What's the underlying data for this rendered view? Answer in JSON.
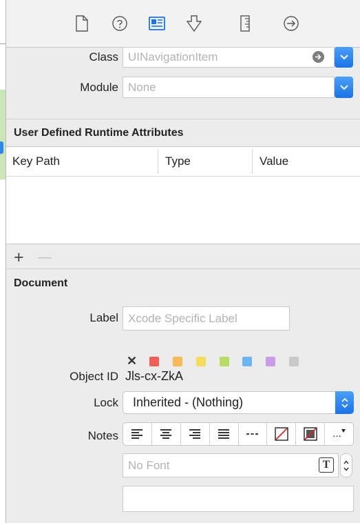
{
  "identity": {
    "class_label": "Class",
    "class_placeholder": "UINavigationItem",
    "module_label": "Module",
    "module_placeholder": "None"
  },
  "runtime_attributes": {
    "title": "User Defined Runtime Attributes",
    "columns": [
      "Key Path",
      "Type",
      "Value"
    ],
    "add_symbol": "+",
    "remove_symbol": "—"
  },
  "document": {
    "title": "Document",
    "label_label": "Label",
    "label_placeholder": "Xcode Specific Label",
    "clear_color_symbol": "✕",
    "color_swatches": [
      "#f25f58",
      "#f7b955",
      "#f4dd5a",
      "#b6dc66",
      "#6cb4f2",
      "#ca9ce6",
      "#c9c9c9"
    ],
    "object_id_label": "Object ID",
    "object_id_value": "Jls-cx-ZkA",
    "lock_label": "Lock",
    "lock_value": "Inherited - (Nothing)",
    "notes_label": "Notes",
    "font_placeholder": "No Font",
    "more_symbol": "...",
    "font_icon_letter": "T"
  },
  "accent_color": "#1a73e8"
}
